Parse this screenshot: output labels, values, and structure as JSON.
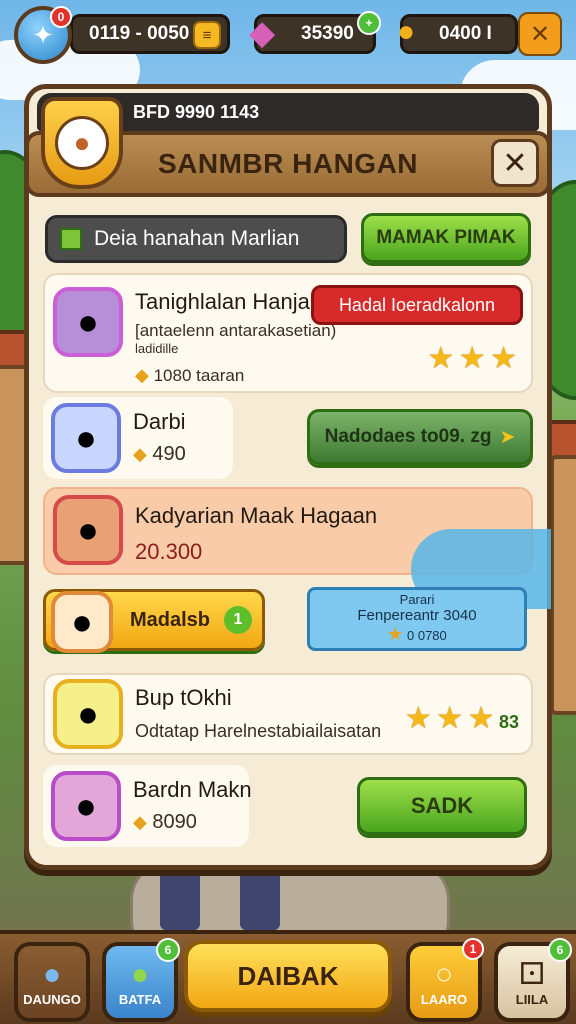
{
  "hud": {
    "timer_text": "0119 - 0050",
    "gems_value": "35390",
    "coins_value": "0400 I",
    "avatar_badge": "0",
    "close_icon": "x-icon"
  },
  "panel": {
    "top_label": "BFD 9990 1143",
    "title": "SANMBR HANGAN",
    "filter_label": "Deia hanahan Marlian",
    "mark_button": "MAMAK PIMAK"
  },
  "rows": [
    {
      "name": "Tanighlalan Hanjan",
      "line2": "[antaelenn antarakasetian)",
      "line3": "ladidille",
      "coins": "1080 taaran",
      "tag": "Hadal Ioeradkalonn",
      "stars": 3
    },
    {
      "name": "Darbi",
      "coins": "490",
      "action": "Nadodaes to09. zg"
    },
    {
      "name": "Kadyarian Maak Hagaan",
      "value": "20.300"
    },
    {
      "name": "Madalsb",
      "badge": "1",
      "popup_line1": "Parari",
      "popup_line2": "Fenpereantr 3040",
      "popup_line3": "0 0780"
    },
    {
      "name": "Bup tOkhi",
      "desc": "Odtatap Harelnestabiailaisatan",
      "stars": 3,
      "stars_suffix": "83"
    },
    {
      "name": "Bardn Makn",
      "coins": "8090",
      "action": "SADK"
    }
  ],
  "nav": {
    "left1": "DAUNGO",
    "left2": "BATFA",
    "center": "DAIBAK",
    "right1": "LAARO",
    "right2": "LIILA",
    "badge_left2": "6",
    "badge_right1": "1",
    "badge_right2": "6"
  },
  "colors": {
    "panel_bg": "#f6ecd6",
    "accent_green": "#4aa51e",
    "accent_red": "#d72a2a",
    "accent_yellow": "#f2a713"
  }
}
